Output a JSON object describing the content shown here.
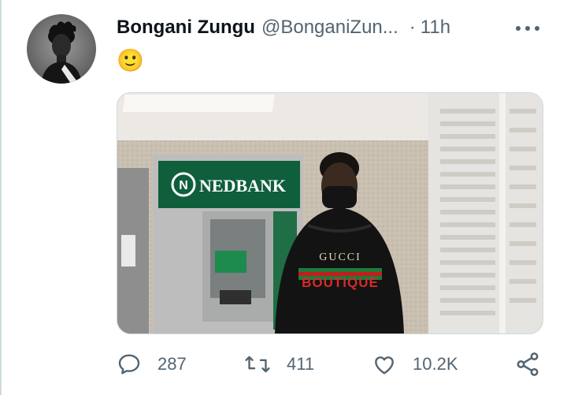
{
  "tweet": {
    "author_name": "Bongani Zungu",
    "handle": "@BonganiZun...",
    "dot": "·",
    "time": "11h",
    "text": "🙂",
    "media": {
      "sign_text": "NEDBANK",
      "shirt_line1": "GUCCI",
      "shirt_line2": "BOUTIQUE"
    },
    "actions": {
      "replies": "287",
      "retweets": "411",
      "likes": "10.2K"
    }
  },
  "icons": [
    "more-icon",
    "reply-icon",
    "retweet-icon",
    "like-icon",
    "share-icon"
  ]
}
